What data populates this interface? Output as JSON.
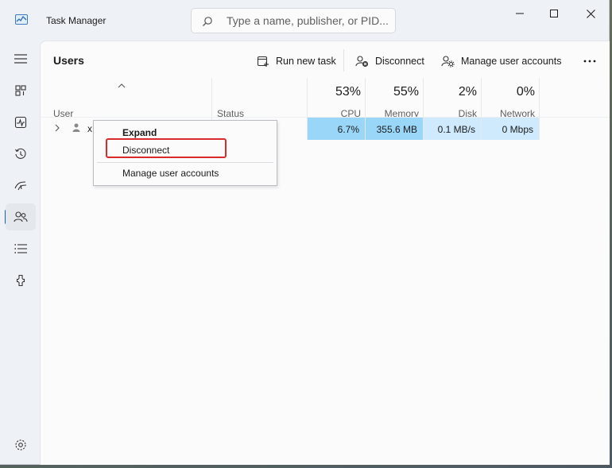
{
  "titlebar": {
    "app_title": "Task Manager",
    "search_placeholder": "Type a name, publisher, or PID..."
  },
  "header": {
    "page_title": "Users",
    "run_new_task": "Run new task",
    "disconnect": "Disconnect",
    "manage_user_accounts": "Manage user accounts"
  },
  "columns": {
    "user": "User",
    "status": "Status",
    "cpu": {
      "percent": "53%",
      "label": "CPU"
    },
    "memory": {
      "percent": "55%",
      "label": "Memory"
    },
    "disk": {
      "percent": "2%",
      "label": "Disk"
    },
    "network": {
      "percent": "0%",
      "label": "Network"
    }
  },
  "rows": [
    {
      "user": "x",
      "status": "",
      "cpu": "6.7%",
      "memory": "355.6 MB",
      "disk": "0.1 MB/s",
      "network": "0 Mbps"
    }
  ],
  "context_menu": {
    "items": [
      "Expand",
      "Disconnect",
      "Manage user accounts"
    ]
  },
  "colors": {
    "cpu_heat": "#99d6f8",
    "memory_heat": "#99d6f8",
    "disk_heat": "#cfeafc",
    "network_heat": "#cfeafc",
    "highlight": "#d92b2b",
    "accent": "#1f5fb5"
  },
  "icons": [
    "app-icon",
    "search-icon",
    "minimize-icon",
    "maximize-icon",
    "close-icon",
    "hamburger-icon",
    "processes-icon",
    "performance-icon",
    "app-history-icon",
    "startup-apps-icon",
    "users-icon",
    "details-icon",
    "services-icon",
    "settings-icon",
    "run-task-icon",
    "disconnect-icon",
    "manage-accounts-icon",
    "more-icon",
    "chevron-right-icon",
    "user-icon",
    "sort-up-icon"
  ]
}
